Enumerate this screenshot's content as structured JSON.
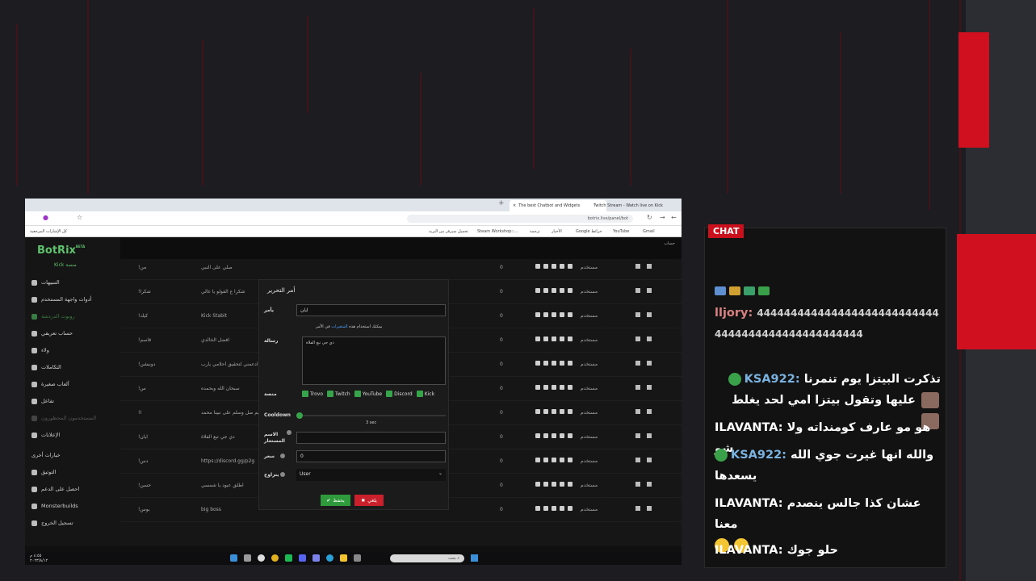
{
  "colors": {
    "accent_green": "#37a34a",
    "accent_red": "#c9202c",
    "chat_header": "#c9101c",
    "username_blue": "#7ab3e0",
    "username_pink": "#d98080",
    "username_white": "#f0f0f0"
  },
  "browser": {
    "tabs": [
      {
        "label": "The best Chatbot and Widgets",
        "active": true
      },
      {
        "label": "Twitch Stream - Watch live on Kick",
        "active": false
      }
    ],
    "url": "botrix.live/panel/bot",
    "bookmarks": [
      "Gmail",
      "YouTube",
      "Google خرائط",
      "الأخبار",
      "ترجمة",
      "Steam Workshop::...",
      "تحميل سيرفر من البريد",
      "كل الإشارات المرجعية"
    ]
  },
  "app": {
    "logo": "BotRix",
    "logo_badge": "BETA",
    "platform_tag": "Kick منصة",
    "account_label": "حساب",
    "menu": [
      {
        "label": "التنبيهات",
        "state": "normal"
      },
      {
        "label": "أدوات واجهة المستخدم",
        "state": "normal"
      },
      {
        "label": "روبوت الدردشة",
        "state": "green"
      },
      {
        "label": "حساب تعريفي",
        "state": "normal"
      },
      {
        "label": "ولاء",
        "state": "normal"
      },
      {
        "label": "التكاملات",
        "state": "normal"
      },
      {
        "label": "ألعاب صغيرة",
        "state": "normal"
      },
      {
        "label": "تفاعل",
        "state": "normal"
      },
      {
        "label": "المستخدمون المحظورون",
        "state": "dim"
      },
      {
        "label": "الإعلانات",
        "state": "normal"
      }
    ],
    "other_title": "خيارات أخرى",
    "other_menu": [
      "التوثيق",
      "احصل على الدعم",
      "Monsterbuilds",
      "تسجيل الخروج"
    ],
    "rows": [
      {
        "cmd": "!من",
        "msg": "صلي على النبي",
        "uses": "0",
        "role": "مستخدم"
      },
      {
        "cmd": "!شكرا",
        "msg": "شكرا ع الفولو يا غالي",
        "uses": "0",
        "role": "مستخدم"
      },
      {
        "cmd": "!كيك",
        "msg": "Kick Stabit",
        "uses": "0",
        "role": "مستخدم"
      },
      {
        "cmd": "!قاسم",
        "msg": "افضل الخالدي",
        "uses": "0",
        "role": "مستخدم"
      },
      {
        "cmd": "!دونيشن",
        "msg": "ادعمني لتحقيق أحلامي يارب",
        "uses": "0",
        "role": "مستخدم"
      },
      {
        "cmd": "!س",
        "msg": "سبحان الله وبحمده",
        "uses": "0",
        "role": "مستخدم"
      },
      {
        "cmd": "!ا",
        "msg": "اللهم صل وسلم على نبينا محمد",
        "uses": "0",
        "role": "مستخدم"
      },
      {
        "cmd": "!ايان",
        "msg": "دي جي تبع الفلاة",
        "uses": "0",
        "role": "مستخدم"
      },
      {
        "cmd": "!دس",
        "msg": "https://discord.gg/p2g",
        "uses": "0",
        "role": "مستخدم"
      },
      {
        "cmd": "!حسن",
        "msg": "اطلق عبود يا شمسي",
        "uses": "0",
        "role": "مستخدم"
      },
      {
        "cmd": "!بوس",
        "msg": "big boss",
        "uses": "0",
        "role": "مستخدم"
      }
    ]
  },
  "modal": {
    "title": "أمر التحرير",
    "command_label": "يأمر",
    "command_value": "ايان",
    "hint_prefix": "يمكنك استخدام هذه",
    "hint_link": "المتغيرات",
    "hint_suffix": "في الأمر",
    "message_label": "رسالة",
    "message_value": "دي جي تبع الفلاة",
    "platform_label": "منصة",
    "platforms": [
      "Trovo",
      "Twitch",
      "YouTube",
      "Discord",
      "Kick"
    ],
    "cooldown_label": "Cooldown",
    "cooldown_value": "3 sec",
    "cooldown_fraction": 0.0,
    "alias_label": "الاسم المستعار",
    "price_label": "سعر",
    "price_value": "0",
    "permission_label": "يتزاوج",
    "permission_value": "User",
    "save_label": "يحفظ",
    "cancel_label": "يلغي"
  },
  "taskbar": {
    "clock_time": "٤:٥٥ م",
    "clock_date": "٢٠٢٣/٨/١٢",
    "search_placeholder": "بحث"
  },
  "chat": {
    "header": "CHAT",
    "messages": [
      {
        "user": "lljory:",
        "user_color": "#d98080",
        "text": "4444444444444444444444444444444444444444444444444"
      },
      {
        "user": "KSA922:",
        "user_color": "#7ab3e0",
        "text": "تذكرت البيتزا يوم تنمرنا عليها وتقول بيتزا امي لحد يغلط"
      },
      {
        "user": "ILAVANTA:",
        "user_color": "#f0f0f0",
        "text": "هو مو عارف كومنداته ولا شو"
      },
      {
        "user": "KSA922:",
        "user_color": "#7ab3e0",
        "text": "والله انها غيرت جوي الله يسعدها"
      },
      {
        "user": "ILAVANTA:",
        "user_color": "#f0f0f0",
        "text": "عشان كذا جالس ينصدم معنا"
      },
      {
        "user": "ILAVANTA:",
        "user_color": "#f0f0f0",
        "text": "حلو جوك"
      }
    ]
  }
}
